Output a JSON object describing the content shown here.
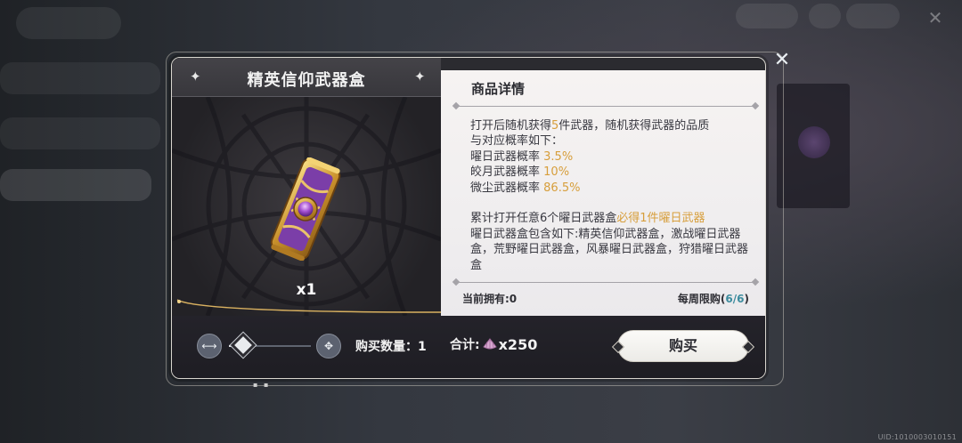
{
  "dialog": {
    "item_title": "精英信仰武器盒",
    "quantity_label": "x1",
    "details_header": "商品详情",
    "description": {
      "line1_pre": "打开后随机获得",
      "line1_num": "5",
      "line1_post": "件武器，随机获得武器的品质",
      "line2": "与对应概率如下：",
      "rates": [
        {
          "name": "曜日武器概率",
          "rate": "3.5%"
        },
        {
          "name": "皎月武器概率",
          "rate": "10%"
        },
        {
          "name": "微尘武器概率",
          "rate": "86.5%"
        }
      ],
      "guarantee_pre": "累计打开任意6个曜日武器盒",
      "guarantee_gold": "必得1件曜日武器",
      "contents_text": "曜日武器盒包含如下:精英信仰武器盒，激战曜日武器盒，荒野曜日武器盒，风暴曜日武器盒，狩猎曜日武器盒"
    },
    "owned_label": "当前拥有:0",
    "weekly_limit_label": "每周限购(",
    "weekly_limit_count": "6/6",
    "weekly_limit_close": ")",
    "buy_quantity_label": "购买数量：1",
    "total_label": "合计:",
    "total_cost": "x250",
    "buy_button": "购买"
  },
  "footer": {
    "uid": "UID:1010003010151"
  },
  "colors": {
    "gold_highlight": "#d79e3b",
    "limit_count": "#3d8c9e"
  },
  "icons": [
    "close-icon",
    "sparkle-icon",
    "minimum-icon",
    "maximum-icon",
    "shell-currency-icon",
    "weapon-box-icon"
  ]
}
